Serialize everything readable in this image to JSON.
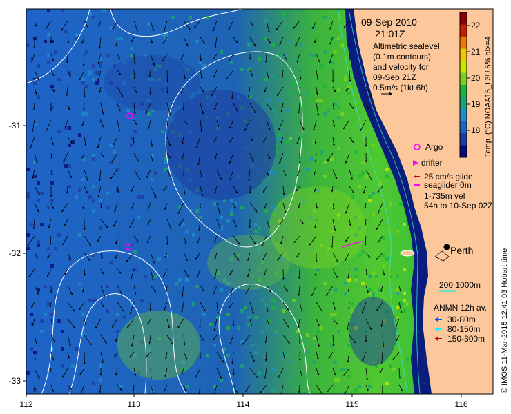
{
  "header": {
    "date": "09-Sep-2010",
    "time": "21:01Z",
    "desc_lines": [
      "Altimetric sealevel",
      "(0.1m contours)",
      "and velocity for",
      "09-Sep 21Z",
      "0.5m/s (1kt 6h)"
    ]
  },
  "axes": {
    "x_ticks": [
      "112",
      "113",
      "114",
      "115",
      "116"
    ],
    "y_ticks": [
      "-31",
      "-32",
      "-33"
    ]
  },
  "colorbar": {
    "label": "Temp. (°C) NOAA15_L3U 5% ql>=4",
    "ticks": [
      "22",
      "21",
      "20",
      "19",
      "18"
    ],
    "colors": [
      "#8b0000",
      "#c81e00",
      "#f07800",
      "#f0c800",
      "#c8e600",
      "#78d21e",
      "#1eb43c",
      "#1ea078",
      "#1e8cc8",
      "#1e64c8",
      "#1e3ca0",
      "#0a0a78"
    ]
  },
  "legend": {
    "argo": "Argo",
    "drifter": "drifter",
    "glide": "25 cm/s glide",
    "seaglider": "seaglider 0m",
    "vel": "1-735m vel",
    "window": "54h to 10-Sep 02Z",
    "city": "Perth",
    "depths": "200  1000m",
    "anmn_title": "ANMN 12h av.",
    "anmn_items": [
      "30-80m",
      "80-150m",
      "150-300m"
    ],
    "anmn_colors": [
      "#0050ff",
      "#00ffff",
      "#c80000"
    ]
  },
  "footer": {
    "credit": "© IMOS 11-Mar-2015 12:41:03 Hobart time"
  },
  "colors": {
    "land": "#fbc79b",
    "coast_deep": "#00008b",
    "contour": "#ffffff",
    "isobath": "#40e0d0"
  }
}
